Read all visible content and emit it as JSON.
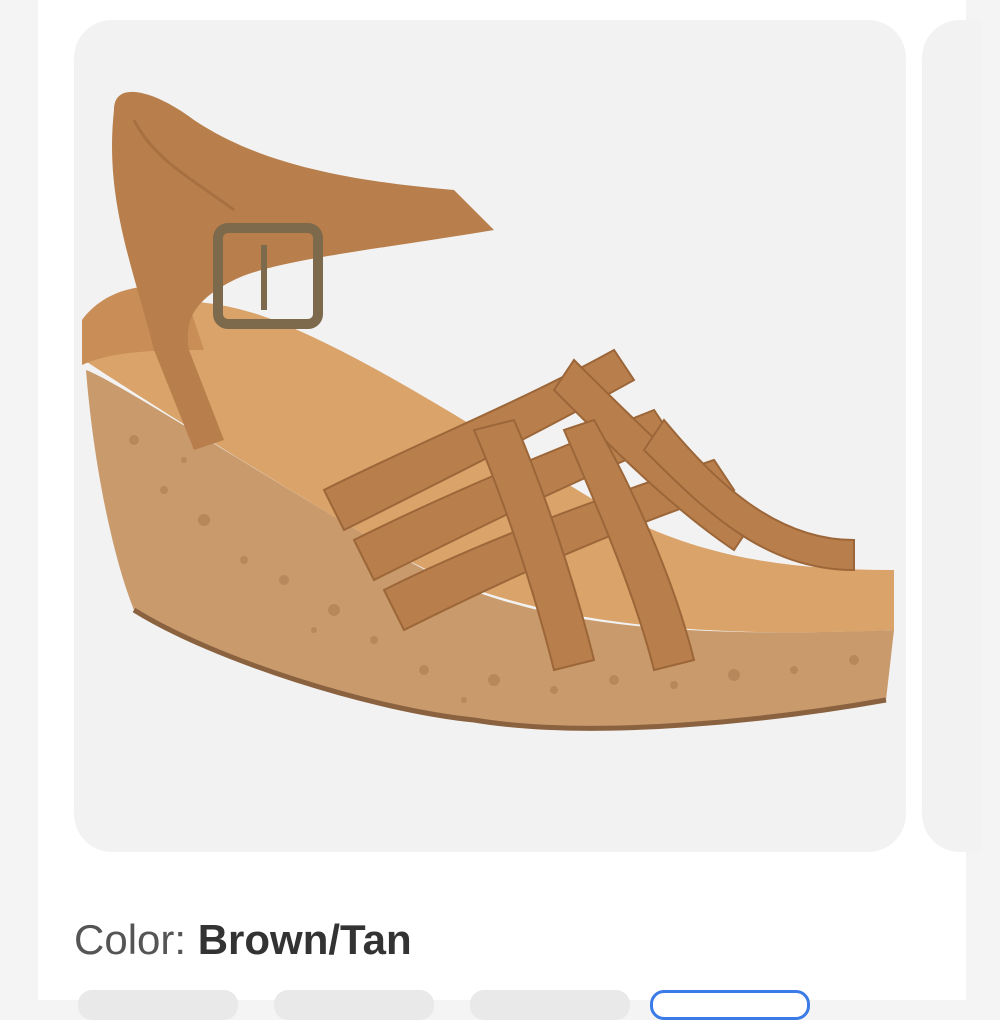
{
  "product": {
    "image_alt": "Brown wedge sandal with woven suede straps and cork wedge",
    "color_label": "Color:",
    "color_value": "Brown/Tan"
  },
  "swatches": [
    {
      "name": "swatch-1",
      "selected": false
    },
    {
      "name": "swatch-2",
      "selected": false
    },
    {
      "name": "swatch-3",
      "selected": false
    },
    {
      "name": "swatch-4",
      "selected": true
    }
  ],
  "colors": {
    "accent": "#3a7be8",
    "suede": "#b87f4d",
    "cork": "#c99a6c",
    "footbed": "#d9a36a"
  }
}
